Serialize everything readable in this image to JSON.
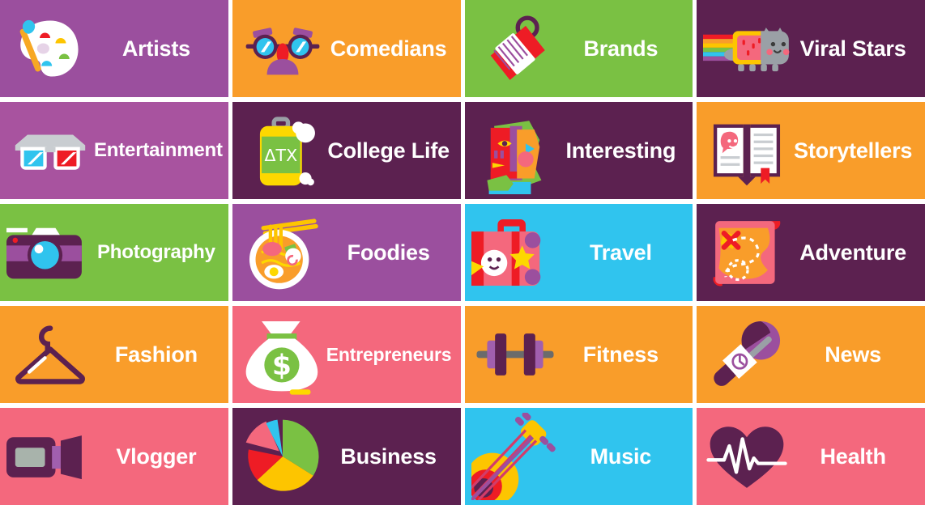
{
  "grid": {
    "columns": 4,
    "rows": 5,
    "tiles": [
      {
        "label": "Artists",
        "icon": "paint-palette-icon",
        "bg": "#9b4f9e",
        "label_size": "lg"
      },
      {
        "label": "Comedians",
        "icon": "funny-glasses-icon",
        "bg": "#f99d2a",
        "label_size": "lg"
      },
      {
        "label": "Brands",
        "icon": "price-tag-icon",
        "bg": "#7ac143",
        "label_size": "lg"
      },
      {
        "label": "Viral Stars",
        "icon": "nyan-cat-icon",
        "bg": "#5c2150",
        "label_size": "lg"
      },
      {
        "label": "Entertainment",
        "icon": "3d-glasses-icon",
        "bg": "#a8539f",
        "label_size": "sm"
      },
      {
        "label": "College Life",
        "icon": "beer-keg-icon",
        "bg": "#5c2150",
        "label_size": "lg"
      },
      {
        "label": "Interesting",
        "icon": "abstract-face-icon",
        "bg": "#5c2150",
        "label_size": "lg"
      },
      {
        "label": "Storytellers",
        "icon": "open-book-icon",
        "bg": "#f99d2a",
        "label_size": "lg"
      },
      {
        "label": "Photography",
        "icon": "camera-icon",
        "bg": "#7ac143",
        "label_size": "sm"
      },
      {
        "label": "Foodies",
        "icon": "ramen-bowl-icon",
        "bg": "#9b4f9e",
        "label_size": "lg"
      },
      {
        "label": "Travel",
        "icon": "suitcase-icon",
        "bg": "#30c4ee",
        "label_size": "lg"
      },
      {
        "label": "Adventure",
        "icon": "treasure-map-icon",
        "bg": "#5c2150",
        "label_size": "lg"
      },
      {
        "label": "Fashion",
        "icon": "clothes-hanger-icon",
        "bg": "#f99d2a",
        "label_size": "lg"
      },
      {
        "label": "Entrepreneurs",
        "icon": "money-bag-icon",
        "bg": "#f4687d",
        "label_size": "xs"
      },
      {
        "label": "Fitness",
        "icon": "dumbbell-icon",
        "bg": "#f99d2a",
        "label_size": "lg"
      },
      {
        "label": "News",
        "icon": "microphone-icon",
        "bg": "#f99d2a",
        "label_size": "lg"
      },
      {
        "label": "Vlogger",
        "icon": "camcorder-icon",
        "bg": "#f4687d",
        "label_size": "lg"
      },
      {
        "label": "Business",
        "icon": "pie-chart-icon",
        "bg": "#5c2150",
        "label_size": "lg"
      },
      {
        "label": "Music",
        "icon": "guitar-icon",
        "bg": "#30c4ee",
        "label_size": "lg"
      },
      {
        "label": "Health",
        "icon": "heart-pulse-icon",
        "bg": "#f4687d",
        "label_size": "lg"
      }
    ]
  },
  "palette": {
    "purple": "#9b4f9e",
    "light_purple": "#a8539f",
    "dark_purple": "#5c2150",
    "orange": "#f99d2a",
    "green": "#7ac143",
    "blue": "#30c4ee",
    "pink": "#f4687d",
    "white": "#ffffff"
  },
  "icon_glyphs": {
    "paint-palette-icon": "artist paint palette with brush",
    "funny-glasses-icon": "novelty disguise glasses with nose",
    "price-tag-icon": "red price tag with ring",
    "nyan-cat-icon": "nyan cat with rainbow trail",
    "3d-glasses-icon": "red and blue anaglyph 3d glasses",
    "beer-keg-icon": "beer keg labelled Greek letters",
    "abstract-face-icon": "cubist abstract profile face",
    "open-book-icon": "open book with bookmark and ghost",
    "camera-icon": "dslr photo camera",
    "ramen-bowl-icon": "ramen noodle bowl with chopsticks",
    "suitcase-icon": "travel suitcase with stickers",
    "treasure-map-icon": "treasure map scroll with X",
    "clothes-hanger-icon": "clothes hanger",
    "money-bag-icon": "money bag with dollar sign",
    "dumbbell-icon": "dumbbell barbell",
    "microphone-icon": "reporter handheld microphone",
    "camcorder-icon": "video camcorder",
    "pie-chart-icon": "pie chart with exploded slice",
    "guitar-icon": "acoustic guitar",
    "heart-pulse-icon": "heart with ecg pulse line"
  },
  "keg_text": "ΔΤΧ"
}
